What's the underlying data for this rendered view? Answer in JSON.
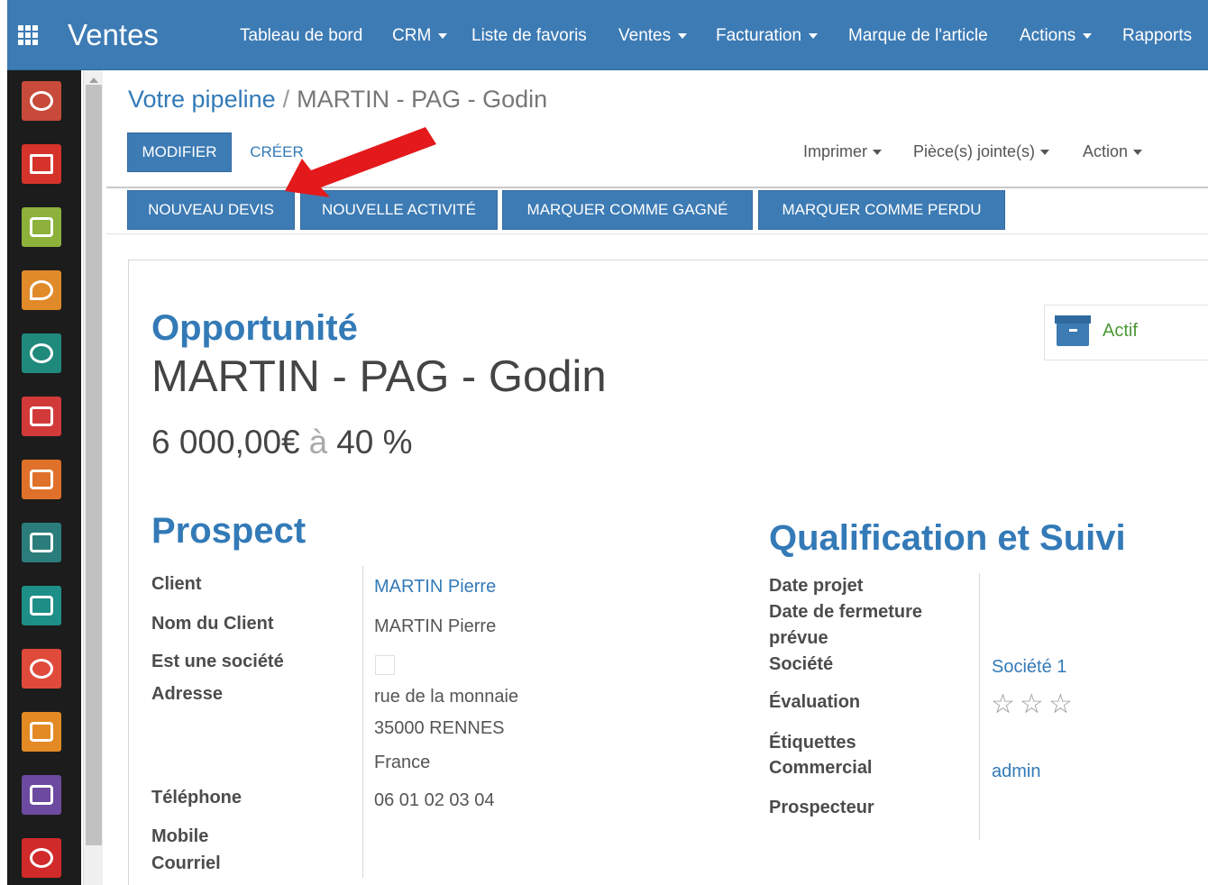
{
  "topbar": {
    "brand": "Ventes",
    "menu": [
      {
        "label": "Tableau de bord",
        "dropdown": false
      },
      {
        "label": "CRM",
        "dropdown": true
      },
      {
        "label": "Liste de favoris",
        "dropdown": false
      },
      {
        "label": "Ventes",
        "dropdown": true
      },
      {
        "label": "Facturation",
        "dropdown": true
      },
      {
        "label": "Marque de l'article",
        "dropdown": false
      },
      {
        "label": "Actions",
        "dropdown": true
      },
      {
        "label": "Rapports",
        "dropdown": false
      }
    ]
  },
  "rail": {
    "apps": [
      {
        "icon": "discuss-icon",
        "color": "#c74a3a"
      },
      {
        "icon": "email-icon",
        "color": "#d6332a"
      },
      {
        "icon": "calendar-icon",
        "color": "#8db13a"
      },
      {
        "icon": "map-pin-icon",
        "color": "#e08a2a"
      },
      {
        "icon": "crm-icon",
        "color": "#1f8a7c"
      },
      {
        "icon": "folder-icon",
        "color": "#d23a3a"
      },
      {
        "icon": "sales-chart-icon",
        "color": "#e0712a"
      },
      {
        "icon": "spreadsheet-icon",
        "color": "#2b7d7b"
      },
      {
        "icon": "payment-card-icon",
        "color": "#1e8f87"
      },
      {
        "icon": "building-icon",
        "color": "#e04a3a"
      },
      {
        "icon": "invoice-icon",
        "color": "#e38a24"
      },
      {
        "icon": "puzzle-icon",
        "color": "#6c4aa0"
      },
      {
        "icon": "timesheet-icon",
        "color": "#d02a2a"
      }
    ]
  },
  "breadcrumb": {
    "parent": "Votre pipeline",
    "separator": "/",
    "current": "MARTIN - PAG - Godin"
  },
  "toolbar": {
    "edit_label": "MODIFIER",
    "create_label": "CRÉER",
    "print_label": "Imprimer",
    "attachments_label": "Pièce(s) jointe(s)",
    "action_label": "Action"
  },
  "actions": {
    "new_quote": "NOUVEAU DEVIS",
    "new_activity": "NOUVELLE ACTIVITÉ",
    "mark_won": "MARQUER COMME GAGNÉ",
    "mark_lost": "MARQUER COMME PERDU"
  },
  "status": {
    "label": "Actif",
    "color": "#4a9a36"
  },
  "record": {
    "type": "Opportunité",
    "name": "MARTIN - PAG - Godin",
    "revenue": "6 000,00€",
    "at": "à",
    "probability": "40 %"
  },
  "prospect": {
    "title": "Prospect",
    "labels": {
      "client": "Client",
      "client_name": "Nom du Client",
      "is_company": "Est une société",
      "address": "Adresse",
      "phone": "Téléphone",
      "mobile": "Mobile",
      "email": "Courriel"
    },
    "values": {
      "client": "MARTIN Pierre",
      "client_name": "MARTIN Pierre",
      "is_company": false,
      "street": "rue de la monnaie",
      "zip_city": "35000   RENNES",
      "country": "France",
      "phone": "06 01 02 03 04"
    }
  },
  "qualification": {
    "title": "Qualification et Suivi",
    "labels": {
      "project_date": "Date projet",
      "closing_date_1": "Date de fermeture",
      "closing_date_2": "prévue",
      "company": "Société",
      "rating": "Évaluation",
      "tags": "Étiquettes",
      "salesperson": "Commercial",
      "prospector": "Prospecteur"
    },
    "values": {
      "company": "Société 1",
      "rating_stars": 0,
      "salesperson": "admin"
    }
  },
  "colors": {
    "brand": "#3d7bb4",
    "link": "#337ab7",
    "annotation_arrow": "#e3191c"
  }
}
